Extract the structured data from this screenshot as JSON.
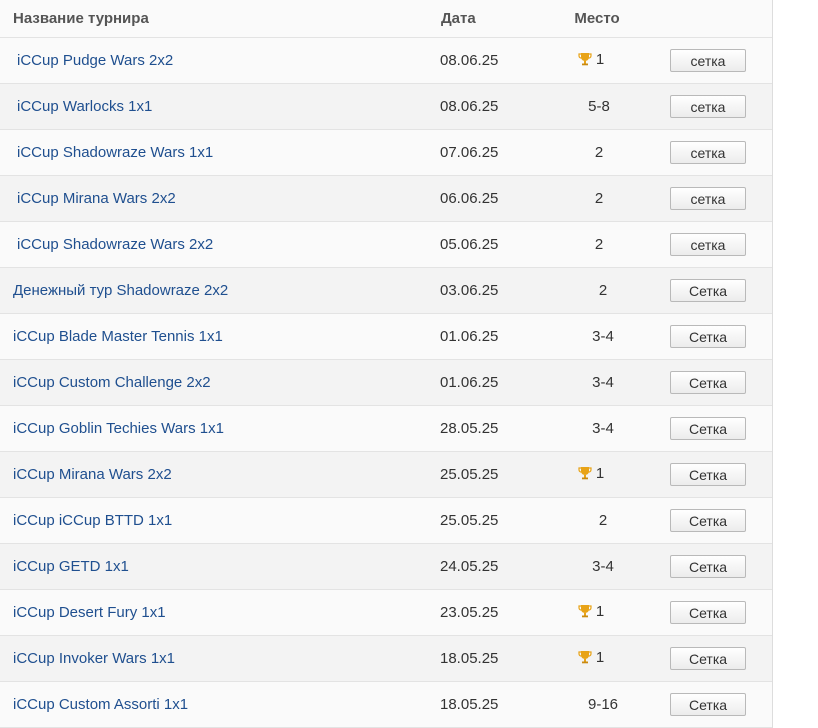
{
  "header": {
    "name": "Название турнира",
    "date": "Дата",
    "place": "Место"
  },
  "rows": [
    {
      "name": "iCCup Pudge Wars 2x2",
      "date": "08.06.25",
      "place": "1",
      "trophy": true,
      "button": "сетка"
    },
    {
      "name": "iCCup Warlocks 1x1",
      "date": "08.06.25",
      "place": "5-8",
      "trophy": false,
      "button": "сетка"
    },
    {
      "name": "iCCup Shadowraze Wars 1x1",
      "date": "07.06.25",
      "place": "2",
      "trophy": false,
      "button": "сетка"
    },
    {
      "name": "iCCup Mirana Wars 2x2",
      "date": "06.06.25",
      "place": "2",
      "trophy": false,
      "button": "сетка"
    },
    {
      "name": "iCCup Shadowraze Wars 2x2",
      "date": "05.06.25",
      "place": "2",
      "trophy": false,
      "button": "сетка"
    },
    {
      "name": "Денежный тур Shadowraze 2x2",
      "date": "03.06.25",
      "place": "2",
      "trophy": false,
      "button": "Сетка"
    },
    {
      "name": "iCCup Blade Master Tennis 1x1",
      "date": "01.06.25",
      "place": "3-4",
      "trophy": false,
      "button": "Сетка"
    },
    {
      "name": "iCCup Custom Challenge 2x2",
      "date": "01.06.25",
      "place": "3-4",
      "trophy": false,
      "button": "Сетка"
    },
    {
      "name": "iCCup Goblin Techies Wars 1x1",
      "date": "28.05.25",
      "place": "3-4",
      "trophy": false,
      "button": "Сетка"
    },
    {
      "name": "iCCup Mirana Wars 2x2",
      "date": "25.05.25",
      "place": "1",
      "trophy": true,
      "button": "Сетка"
    },
    {
      "name": "iCCup iCCup BTTD 1x1",
      "date": "25.05.25",
      "place": "2",
      "trophy": false,
      "button": "Сетка"
    },
    {
      "name": "iCCup GETD 1x1",
      "date": "24.05.25",
      "place": "3-4",
      "trophy": false,
      "button": "Сетка"
    },
    {
      "name": "iCCup Desert Fury 1x1",
      "date": "23.05.25",
      "place": "1",
      "trophy": true,
      "button": "Сетка"
    },
    {
      "name": "iCCup Invoker Wars 1x1",
      "date": "18.05.25",
      "place": "1",
      "trophy": true,
      "button": "Сетка"
    },
    {
      "name": "iCCup Custom Assorti 1x1",
      "date": "18.05.25",
      "place": "9-16",
      "trophy": false,
      "button": "Сетка"
    }
  ],
  "colors": {
    "link": "#1f4f8f",
    "trophy": "#e8a317"
  },
  "icons": {
    "trophy": "trophy-icon"
  }
}
